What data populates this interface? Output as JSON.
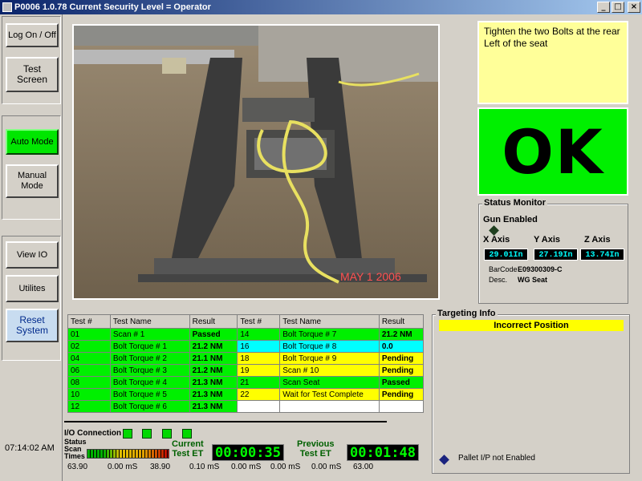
{
  "window": {
    "title": "P0006 1.0.78  Current Security Level = Operator",
    "minimize": "_",
    "maximize": "□",
    "close": "×"
  },
  "sidebar": {
    "log_on_off": "Log On / Off",
    "test_screen": "Test Screen",
    "auto_mode": "Auto Mode",
    "manual_mode": "Manual Mode",
    "view_io": "View IO",
    "utilities": "Utilites",
    "reset_system": "Reset System",
    "clock": "07:14:02 AM"
  },
  "photo": {
    "date_stamp": "MAY 1 2006"
  },
  "instruction": "Tighten the two Bolts at the rear Left of the seat",
  "ok_status": "OK",
  "status_monitor": {
    "title": "Status Monitor",
    "gun_label": "Gun Enabled",
    "x_label": "X Axis",
    "y_label": "Y Axis",
    "z_label": "Z Axis",
    "x_value": "29.01In",
    "y_value": "27.19In",
    "z_value": "13.74In",
    "barcode_label": "BarCode",
    "barcode_value": "E09300309-C",
    "desc_label": "Desc.",
    "desc_value": "WG Seat"
  },
  "results": {
    "headers": [
      "Test #",
      "Test Name",
      "Result",
      "Test #",
      "Test Name",
      "Result"
    ],
    "rows": [
      {
        "t1": "01",
        "n1": "Scan # 1",
        "r1": "Passed",
        "c1": "#00f000",
        "t2": "14",
        "n2": "Bolt Torque # 7",
        "r2": "21.2 NM",
        "c2": "#00f000"
      },
      {
        "t1": "02",
        "n1": "Bolt Torque # 1",
        "r1": "21.2 NM",
        "c1": "#00f000",
        "t2": "16",
        "n2": "Bolt Torque # 8",
        "r2": "0.0",
        "c2": "#00ffff"
      },
      {
        "t1": "04",
        "n1": "Bolt Torque # 2",
        "r1": "21.1 NM",
        "c1": "#00f000",
        "t2": "18",
        "n2": "Bolt Torque # 9",
        "r2": "Pending",
        "c2": "#ffff00"
      },
      {
        "t1": "06",
        "n1": "Bolt Torque # 3",
        "r1": "21.2 NM",
        "c1": "#00f000",
        "t2": "19",
        "n2": "Scan # 10",
        "r2": "Pending",
        "c2": "#ffff00"
      },
      {
        "t1": "08",
        "n1": "Bolt Torque # 4",
        "r1": "21.3 NM",
        "c1": "#00f000",
        "t2": "21",
        "n2": "Scan Seat",
        "r2": "Passed",
        "c2": "#00f000"
      },
      {
        "t1": "10",
        "n1": "Bolt Torque # 5",
        "r1": "21.3 NM",
        "c1": "#00f000",
        "t2": "22",
        "n2": "Wait for Test Complete",
        "r2": "Pending",
        "c2": "#ffff00"
      },
      {
        "t1": "12",
        "n1": "Bolt Torque # 6",
        "r1": "21.3 NM",
        "c1": "#00f000",
        "t2": "",
        "n2": "",
        "r2": "",
        "c2": "#ffffff"
      }
    ]
  },
  "targeting": {
    "title": "Targeting Info",
    "status": "Incorrect Position",
    "pallet": "Pallet I/P not Enabled"
  },
  "bottom": {
    "io_label": "I/O Connection",
    "scan_label_1": "Status",
    "scan_label_2": "Scan",
    "scan_label_3": "Times",
    "min_val": "63.90",
    "scan_time_1": "0.00 mS",
    "max_val": "38.90",
    "current_label_1": "Current",
    "current_label_2": "Test ET",
    "current_et": "00:00:35",
    "scan_time_2": "0.10 mS",
    "scan_time_3": "0.00 mS",
    "scan_time_4": "0.00 mS",
    "previous_label_1": "Previous",
    "previous_label_2": "Test ET",
    "previous_et": "00:01:48",
    "scan_time_5": "0.00 mS",
    "final_val": "63.00"
  },
  "colors": {
    "ok_green": "#00f000",
    "instruction_bg": "#ffff99",
    "pending_yellow": "#ffff00",
    "active_cyan": "#00ffff"
  }
}
